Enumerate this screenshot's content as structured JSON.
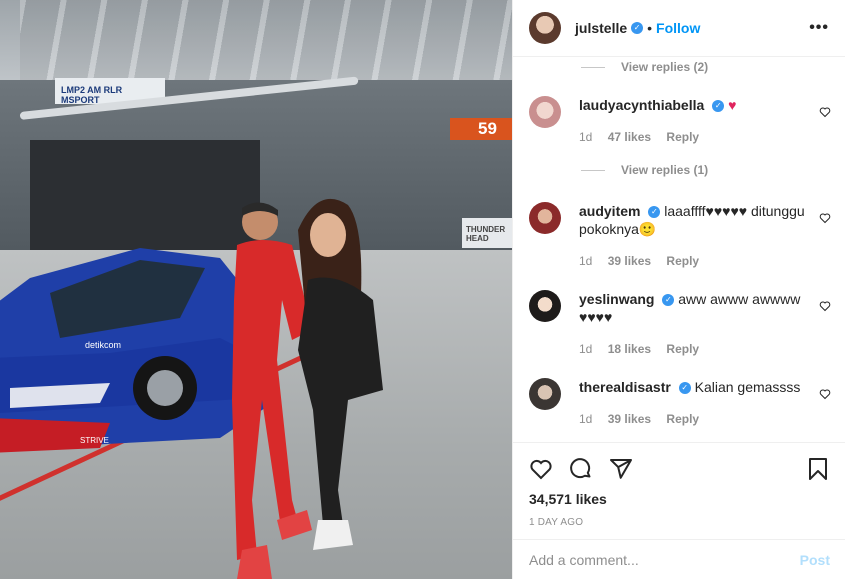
{
  "post": {
    "username": "julstelle",
    "follow_label": "Follow",
    "dot": "•",
    "more": "•••"
  },
  "photo_text": {
    "banner1": "LMP2 AM    RLR MSPORT",
    "num59": "59",
    "thunder": "THUNDER HEAD",
    "car_sponsor": "detikcom",
    "car_sponsor2": "STRIVE"
  },
  "replies": [
    {
      "label": "View replies (2)"
    },
    {
      "label": "View replies (1)"
    }
  ],
  "comments": [
    {
      "user": "laudyacynthiabella",
      "text": "♥",
      "age": "1d",
      "likes": "47 likes",
      "reply": "Reply"
    },
    {
      "user": "audyitem",
      "text": "laaaffff♥♥♥♥♥ ditunggu pokoknya🙂",
      "age": "1d",
      "likes": "39 likes",
      "reply": "Reply"
    },
    {
      "user": "yeslinwang",
      "text": "aww awww awwww ♥♥♥♥",
      "age": "1d",
      "likes": "18 likes",
      "reply": "Reply"
    },
    {
      "user": "therealdisastr",
      "text": "Kalian gemassss",
      "age": "1d",
      "likes": "39 likes",
      "reply": "Reply"
    }
  ],
  "stats": {
    "likes": "34,571 likes",
    "ago": "1 DAY AGO"
  },
  "composer": {
    "placeholder": "Add a comment...",
    "post_label": "Post"
  },
  "colors": {
    "accent": "#0095f6",
    "verified": "#3897f0",
    "heart": "#e0245e"
  }
}
